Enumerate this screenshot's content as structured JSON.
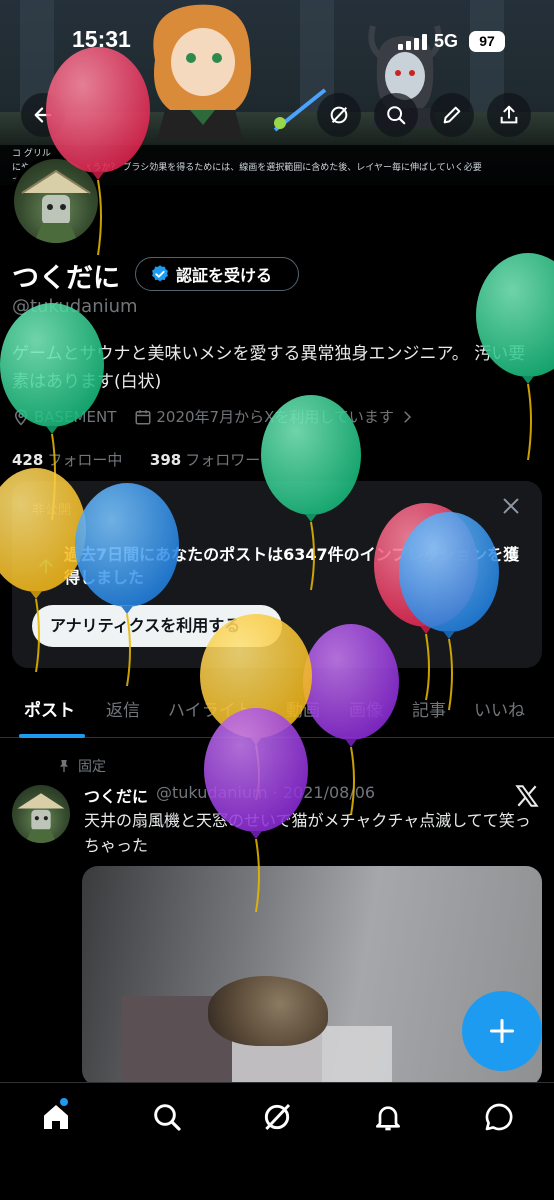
{
  "status_bar": {
    "time": "15:31",
    "network": "5G",
    "battery": "97"
  },
  "banner_text": "コ グリル\nにやって見せましょうか？ ブラシ効果を得るためには、線画を選択範囲に含めた後、レイヤー毎に伸ばしていく必要\nす。",
  "profile": {
    "name": "つくだに",
    "verify_label": "認証を受ける",
    "handle": "@tukudanium",
    "bio": "ゲームとサウナと美味いメシを愛する異常独身エンジニア。 汚い要素はあります(白状)",
    "location": "BASEMENT",
    "joined": "2020年7月からXを利用しています",
    "following_count": "428",
    "following_label": "フォロー中",
    "followers_count": "398",
    "followers_label": "フォロワー"
  },
  "card": {
    "label": "非公開",
    "text": "過去7日間にあなたのポストは6347件のインプレッションを獲得しました",
    "button": "アナリティクスを利用する"
  },
  "tabs": [
    "ポスト",
    "返信",
    "ハイライト",
    "動画",
    "画像",
    "記事",
    "いいね"
  ],
  "post": {
    "pinned_label": "固定",
    "author": "つくだに",
    "handle_date": "@tukudanium · 2021/08/06",
    "text": "天井の扇風機と天窓のせいで猫がメチャクチャ点滅してて笑っちゃった"
  },
  "colors": {
    "accent": "#1d9bf0",
    "background": "#000000",
    "secondary_text": "#71767b"
  },
  "icons": [
    "back-arrow-icon",
    "grok-icon",
    "search-icon",
    "edit-icon",
    "share-icon",
    "verified-check-icon",
    "location-icon",
    "calendar-icon",
    "chevron-right-icon",
    "close-icon",
    "arrow-up-icon",
    "pin-icon",
    "x-logo-icon",
    "plus-icon",
    "home-icon",
    "search-nav-icon",
    "grok-nav-icon",
    "bell-icon",
    "messages-icon"
  ]
}
